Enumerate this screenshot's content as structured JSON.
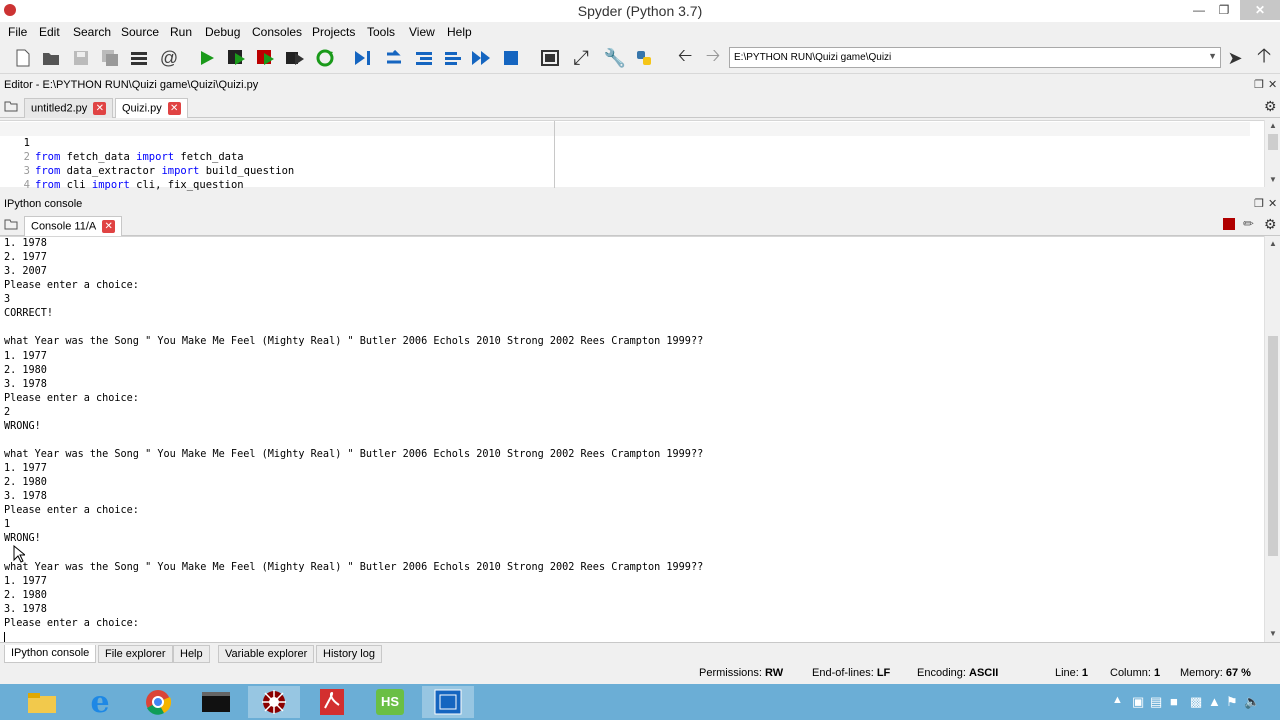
{
  "window": {
    "title": "Spyder (Python 3.7)"
  },
  "menu": [
    "File",
    "Edit",
    "Search",
    "Source",
    "Run",
    "Debug",
    "Consoles",
    "Projects",
    "Tools",
    "View",
    "Help"
  ],
  "toolbar": {
    "path": "E:\\PYTHON RUN\\Quizi game\\Quizi"
  },
  "editor": {
    "header": "Editor - E:\\PYTHON RUN\\Quizi game\\Quizi\\Quizi.py",
    "tabs": [
      "untitled2.py",
      "Quizi.py"
    ],
    "lines": [
      {
        "num": "1",
        "kw1": "from",
        "mod": " fetch_data ",
        "kw2": "import",
        "names": " fetch_data"
      },
      {
        "num": "2",
        "kw1": "from",
        "mod": " data_extractor ",
        "kw2": "import",
        "names": " build_question"
      },
      {
        "num": "3",
        "kw1": "from",
        "mod": " cli ",
        "kw2": "import",
        "names": " cli, fix_question"
      },
      {
        "num": "4",
        "kw1": "",
        "mod": "",
        "kw2": "",
        "names": ""
      }
    ]
  },
  "console": {
    "header": "IPython console",
    "tab": "Console 11/A",
    "lines": [
      "1. 1978",
      "2. 1977",
      "3. 2007",
      "Please enter a choice:",
      "3",
      "CORRECT!",
      "",
      "what Year was the Song \" You Make Me Feel (Mighty Real) \" Butler 2006 Echols 2010 Strong 2002 Rees Crampton 1999??",
      "1. 1977",
      "2. 1980",
      "3. 1978",
      "Please enter a choice:",
      "2",
      "WRONG!",
      "",
      "what Year was the Song \" You Make Me Feel (Mighty Real) \" Butler 2006 Echols 2010 Strong 2002 Rees Crampton 1999??",
      "1. 1977",
      "2. 1980",
      "3. 1978",
      "Please enter a choice:",
      "1",
      "WRONG!",
      "",
      "what Year was the Song \" You Make Me Feel (Mighty Real) \" Butler 2006 Echols 2010 Strong 2002 Rees Crampton 1999??",
      "1. 1977",
      "2. 1980",
      "3. 1978",
      "Please enter a choice:",
      ""
    ]
  },
  "bottom_tabs": [
    "IPython console",
    "File explorer",
    "Help",
    "Variable explorer",
    "History log"
  ],
  "status": {
    "permissions_label": "Permissions:",
    "permissions": "RW",
    "eol_label": "End-of-lines:",
    "eol": "LF",
    "encoding_label": "Encoding:",
    "encoding": "ASCII",
    "line_label": "Line:",
    "line": "1",
    "column_label": "Column:",
    "column": "1",
    "memory_label": "Memory:",
    "memory": "67 %"
  },
  "taskbar": {
    "apps": [
      "file-explorer-icon",
      "internet-explorer-icon",
      "chrome-icon",
      "terminal-icon",
      "spyder-icon",
      "acrobat-icon",
      "hs-icon",
      "window-icon"
    ],
    "hs_label": "HS"
  },
  "colors": {
    "accent": "#0000ff",
    "taskbar": "#6baed6",
    "close_tab": "#e04343"
  }
}
